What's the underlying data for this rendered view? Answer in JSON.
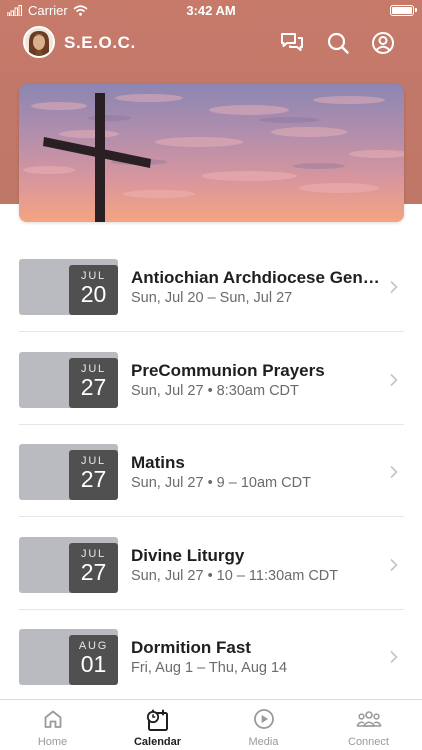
{
  "status_bar": {
    "carrier": "Carrier",
    "time": "3:42 AM"
  },
  "header": {
    "title": "S.E.O.C."
  },
  "events": [
    {
      "month": "JUL",
      "day": "20",
      "title": "Antiochian Archdiocese Gener...",
      "subtitle": "Sun, Jul 20 – Sun, Jul 27"
    },
    {
      "month": "JUL",
      "day": "27",
      "title": "PreCommunion Prayers",
      "subtitle": "Sun, Jul 27 • 8:30am CDT"
    },
    {
      "month": "JUL",
      "day": "27",
      "title": "Matins",
      "subtitle": "Sun, Jul 27 • 9 – 10am CDT"
    },
    {
      "month": "JUL",
      "day": "27",
      "title": "Divine Liturgy",
      "subtitle": "Sun, Jul 27 • 10 – 11:30am CDT"
    },
    {
      "month": "AUG",
      "day": "01",
      "title": "Dormition Fast",
      "subtitle": "Fri, Aug 1 – Thu, Aug 14"
    }
  ],
  "tabs": [
    {
      "label": "Home",
      "icon": "home-icon",
      "active": false
    },
    {
      "label": "Calendar",
      "icon": "calendar-icon",
      "active": true
    },
    {
      "label": "Media",
      "icon": "play-icon",
      "active": false
    },
    {
      "label": "Connect",
      "icon": "people-icon",
      "active": false
    }
  ],
  "colors": {
    "header": "#c27869",
    "badge": "#505050",
    "thumb": "#b9bbc0"
  }
}
